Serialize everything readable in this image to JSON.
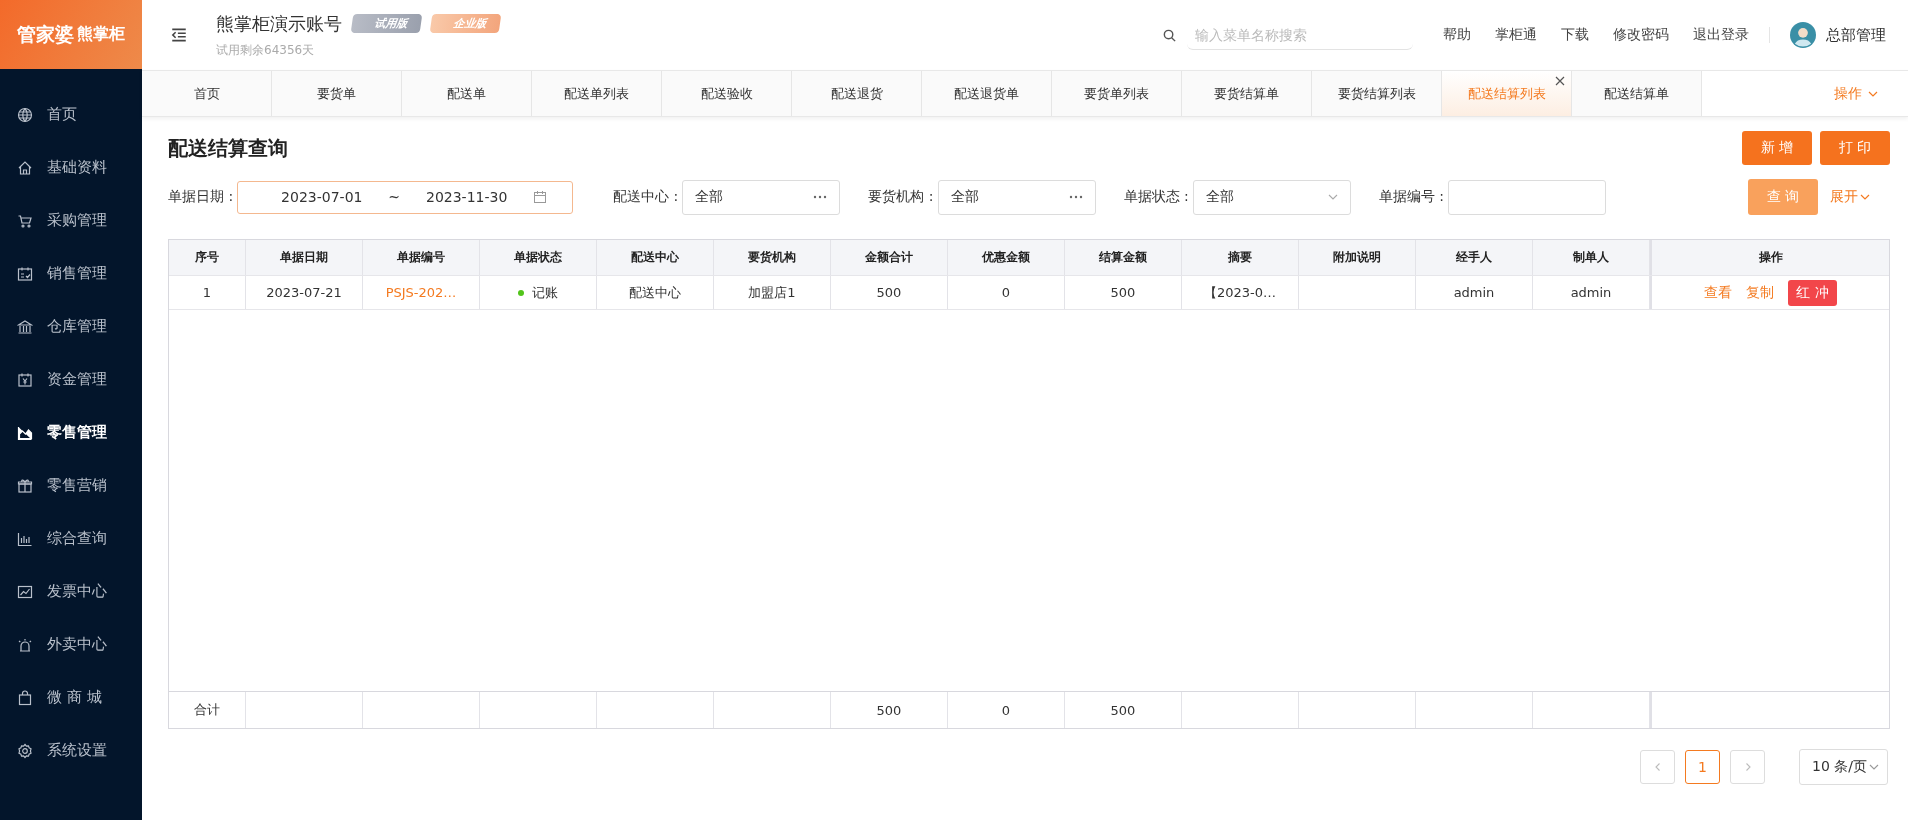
{
  "logo": {
    "brand": "管家婆",
    "product": "熊掌柜"
  },
  "sidebar": {
    "items": [
      {
        "label": "首页",
        "selected": false
      },
      {
        "label": "基础资料",
        "selected": false
      },
      {
        "label": "采购管理",
        "selected": false
      },
      {
        "label": "销售管理",
        "selected": false
      },
      {
        "label": "仓库管理",
        "selected": false
      },
      {
        "label": "资金管理",
        "selected": false
      },
      {
        "label": "零售管理",
        "selected": true
      },
      {
        "label": "零售营销",
        "selected": false
      },
      {
        "label": "综合查询",
        "selected": false
      },
      {
        "label": "发票中心",
        "selected": false
      },
      {
        "label": "外卖中心",
        "selected": false
      },
      {
        "label": "微 商 城",
        "selected": false
      },
      {
        "label": "系统设置",
        "selected": false
      }
    ]
  },
  "header": {
    "account": "熊掌柜演示账号",
    "badges": [
      "试用版",
      "企业版"
    ],
    "trial_note": "试用剩余64356天",
    "search": {
      "placeholder": "输入菜单名称搜索"
    },
    "links": [
      "帮助",
      "掌柜通",
      "下载",
      "修改密码",
      "退出登录"
    ],
    "user": "总部管理"
  },
  "tabs": [
    {
      "label": "首页",
      "selected": false
    },
    {
      "label": "要货单",
      "selected": false
    },
    {
      "label": "配送单",
      "selected": false
    },
    {
      "label": "配送单列表",
      "selected": false
    },
    {
      "label": "配送验收",
      "selected": false
    },
    {
      "label": "配送退货",
      "selected": false
    },
    {
      "label": "配送退货单",
      "selected": false
    },
    {
      "label": "要货单列表",
      "selected": false
    },
    {
      "label": "要货结算单",
      "selected": false
    },
    {
      "label": "要货结算列表",
      "selected": false
    },
    {
      "label": "配送结算列表",
      "selected": true
    },
    {
      "label": "配送结算单",
      "selected": false
    }
  ],
  "tab_actions": "操作",
  "page": {
    "title": "配送结算查询",
    "buttons": [
      "新 增",
      "打 印"
    ]
  },
  "filters": {
    "date_label": "单据日期 :",
    "date_from": "2023-07-01",
    "date_sep": "~",
    "date_to": "2023-11-30",
    "fields": [
      {
        "label": "配送中心 :",
        "value": "全部",
        "kind": "picker"
      },
      {
        "label": "要货机构 :",
        "value": "全部",
        "kind": "picker"
      },
      {
        "label": "单据状态 :",
        "value": "全部",
        "kind": "select"
      },
      {
        "label": "单据编号 :",
        "kind": "text"
      }
    ],
    "query": "查 询",
    "expand": "展开"
  },
  "table": {
    "columns": [
      "序号",
      "单据日期",
      "单据编号",
      "单据状态",
      "配送中心",
      "要货机构",
      "金额合计",
      "优惠金额",
      "结算金额",
      "摘要",
      "附加说明",
      "经手人",
      "制单人",
      "操作"
    ],
    "rows": [
      {
        "cells": [
          "1",
          "2023-07-21",
          "PSJS-202…",
          "记账",
          "配送中心",
          "加盟店1",
          "500",
          "0",
          "500",
          "【2023-0…",
          null,
          "admin",
          "admin"
        ],
        "color": "#52c41a",
        "actions": [
          "查看",
          "复制",
          "红 冲"
        ]
      }
    ],
    "footer": {
      "label": "合计",
      "amount_total": "500",
      "discount_total": "0",
      "settlement_total": "500"
    }
  },
  "pagination": {
    "pages": [
      {
        "label": "1",
        "selected": true
      }
    ],
    "page_size": "10 条/页"
  }
}
